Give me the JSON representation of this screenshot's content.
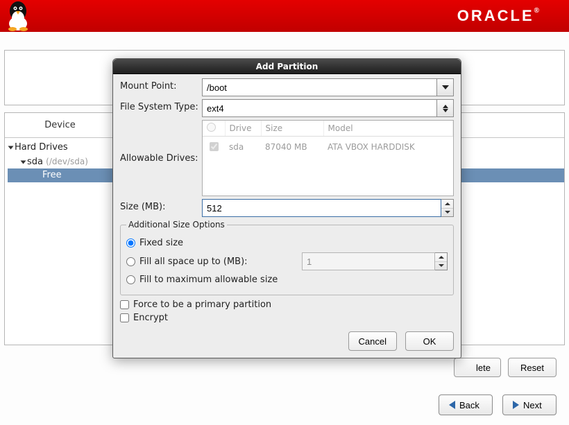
{
  "banner": {
    "brand": "ORACLE"
  },
  "table": {
    "header_device": "Device",
    "tree": {
      "root": "Hard Drives",
      "sda_label": "sda",
      "sda_path": "(/dev/sda)",
      "free_label": "Free"
    }
  },
  "sideButtons": {
    "delete": "Delete",
    "reset": "Reset"
  },
  "wizard": {
    "back": "Back",
    "next": "Next"
  },
  "dialog": {
    "title": "Add Partition",
    "mount_label": "Mount Point:",
    "mount_value": "/boot",
    "fstype_label": "File System Type:",
    "fstype_value": "ext4",
    "allowable_label": "Allowable Drives:",
    "drives": {
      "headers": {
        "check": "",
        "drive": "Drive",
        "size": "Size",
        "model": "Model"
      },
      "rows": [
        {
          "checked": true,
          "drive": "sda",
          "size": "87040 MB",
          "model": "ATA VBOX HARDDISK"
        }
      ]
    },
    "size_label": "Size (MB):",
    "size_value": "512",
    "addl_legend": "Additional Size Options",
    "opt_fixed": "Fixed size",
    "opt_fillupto": "Fill all space up to (MB):",
    "fillupto_value": "1",
    "opt_fillmax": "Fill to maximum allowable size",
    "force_primary": "Force to be a primary partition",
    "encrypt": "Encrypt",
    "cancel": "Cancel",
    "ok": "OK",
    "size_option_selected": "fixed"
  }
}
